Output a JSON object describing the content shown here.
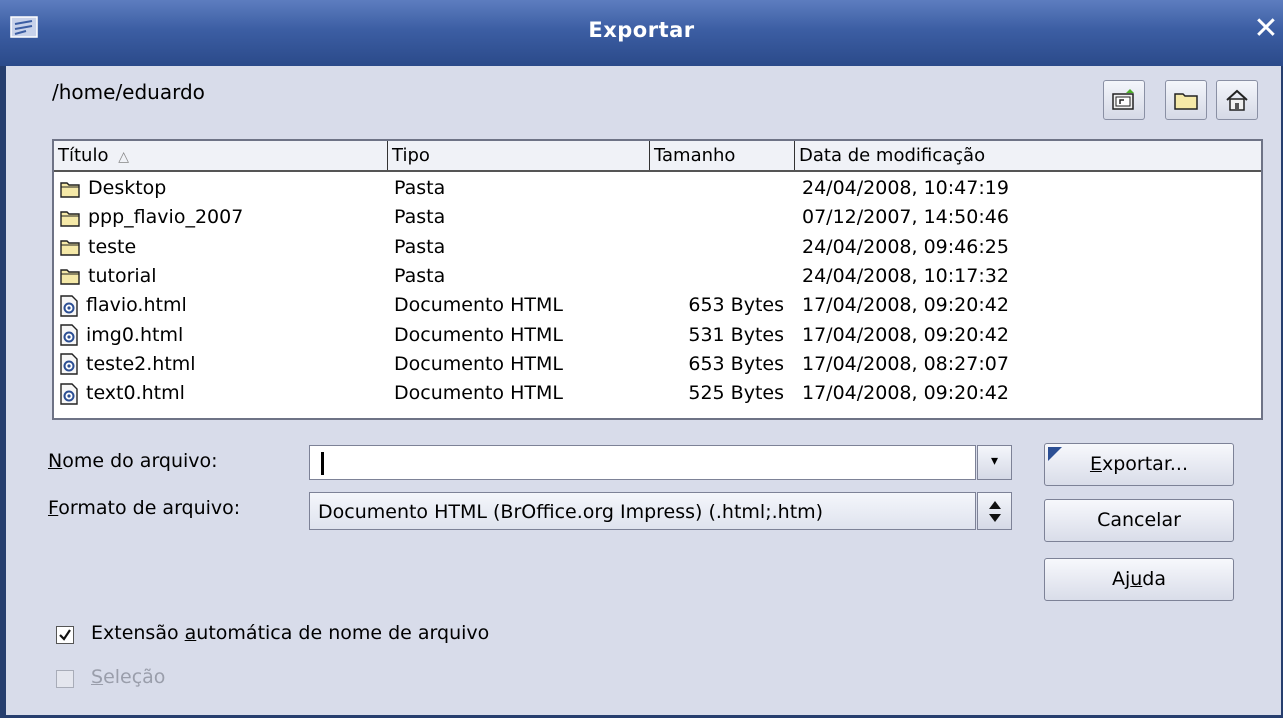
{
  "window": {
    "title": "Exportar"
  },
  "path": "/home/eduardo",
  "toolbar": {
    "up_icon": "folder-up-icon",
    "new_folder_icon": "new-folder-icon",
    "home_icon": "home-icon"
  },
  "columns": {
    "title": "Título",
    "type": "Tipo",
    "size": "Tamanho",
    "modified": "Data de modificação"
  },
  "files": [
    {
      "name": "Desktop",
      "type": "Pasta",
      "size": "",
      "modified": "24/04/2008, 10:47:19",
      "icon": "folder-icon"
    },
    {
      "name": "ppp_flavio_2007",
      "type": "Pasta",
      "size": "",
      "modified": "07/12/2007, 14:50:46",
      "icon": "folder-icon"
    },
    {
      "name": "teste",
      "type": "Pasta",
      "size": "",
      "modified": "24/04/2008, 09:46:25",
      "icon": "folder-icon"
    },
    {
      "name": "tutorial",
      "type": "Pasta",
      "size": "",
      "modified": "24/04/2008, 10:17:32",
      "icon": "folder-icon"
    },
    {
      "name": "flavio.html",
      "type": "Documento HTML",
      "size": "653 Bytes",
      "modified": "17/04/2008, 09:20:42",
      "icon": "html-file-icon"
    },
    {
      "name": "img0.html",
      "type": "Documento HTML",
      "size": "531 Bytes",
      "modified": "17/04/2008, 09:20:42",
      "icon": "html-file-icon"
    },
    {
      "name": "teste2.html",
      "type": "Documento HTML",
      "size": "653 Bytes",
      "modified": "17/04/2008, 08:27:07",
      "icon": "html-file-icon"
    },
    {
      "name": "text0.html",
      "type": "Documento HTML",
      "size": "525 Bytes",
      "modified": "17/04/2008, 09:20:42",
      "icon": "html-file-icon"
    }
  ],
  "filename": {
    "mnemonic": "N",
    "label_rest": "ome do arquivo:",
    "value": ""
  },
  "format": {
    "mnemonic": "F",
    "label_rest": "ormato de arquivo:",
    "value": "Documento HTML (BrOffice.org Impress) (.html;.htm)"
  },
  "buttons": {
    "export": {
      "mnemonic": "E",
      "rest": "xportar..."
    },
    "cancel": "Cancelar",
    "help": {
      "pre": "Aj",
      "mnemonic": "u",
      "post": "da"
    }
  },
  "options": {
    "auto_ext": {
      "pre": "Extensão ",
      "mnemonic": "a",
      "post": "utomática de nome de arquivo",
      "checked": true
    },
    "selection": {
      "mnemonic": "S",
      "rest": "eleção",
      "checked": false,
      "enabled": false
    }
  },
  "colors": {
    "title_bar": "#3c5ea3",
    "dialog_bg": "#d8dcea",
    "folder": "#f5e9a8"
  }
}
